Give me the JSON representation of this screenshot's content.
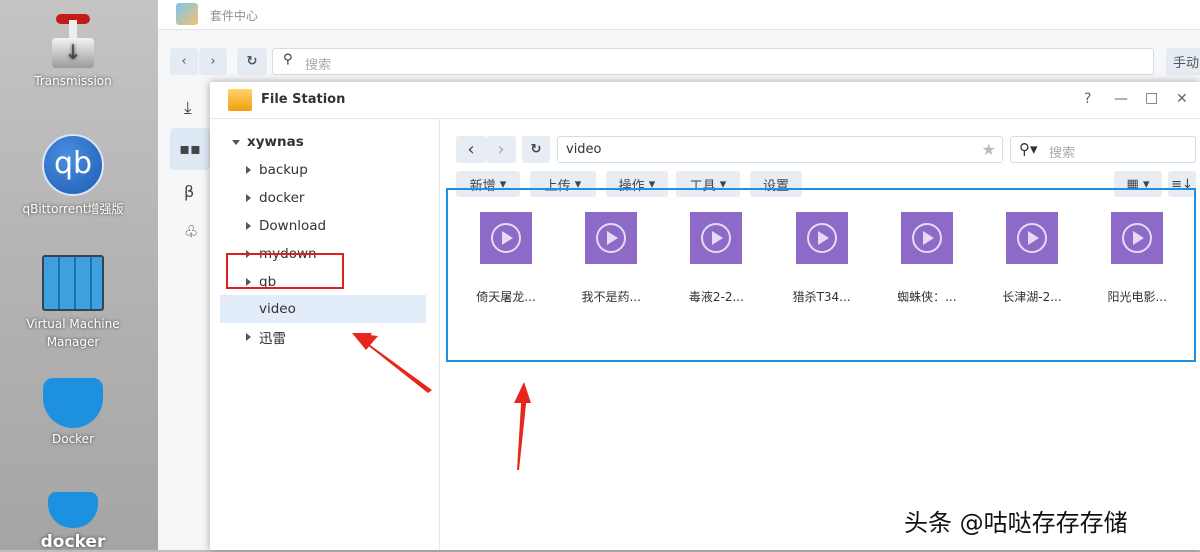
{
  "desktop": {
    "icons": [
      {
        "label": "Transmission"
      },
      {
        "label": "qBittorrent增强版"
      },
      {
        "label": "Virtual Machine Manager"
      },
      {
        "label": "Docker"
      },
      {
        "label": "docker"
      }
    ]
  },
  "package_center": {
    "title": "套件中心",
    "search_placeholder": "搜索",
    "manual_button": "手动"
  },
  "file_station": {
    "title": "File Station",
    "window_controls": [
      "?",
      "—",
      "□",
      "✕"
    ],
    "path": "video",
    "search_placeholder": "搜索",
    "toolbar": {
      "new": "新增",
      "upload": "上传",
      "action": "操作",
      "tools": "工具",
      "settings": "设置"
    },
    "tree": {
      "root": "xywnas",
      "folders": [
        "backup",
        "docker",
        "Download",
        "mydown",
        "qb",
        "video",
        "迅雷"
      ],
      "selected": "video"
    },
    "files": [
      "倚天屠龙...",
      "我不是药...",
      "毒液2-2...",
      "猎杀T34...",
      "蜘蛛侠：...",
      "长津湖-2...",
      "阳光电影..."
    ],
    "file_icon_color": "#8e6ac8"
  },
  "annotations": {
    "highlight_box_color": "#1e90e6",
    "selection_box_color": "#e02020",
    "arrow_color": "#e8261c"
  },
  "watermark": "头条 @咕哒存存存储"
}
